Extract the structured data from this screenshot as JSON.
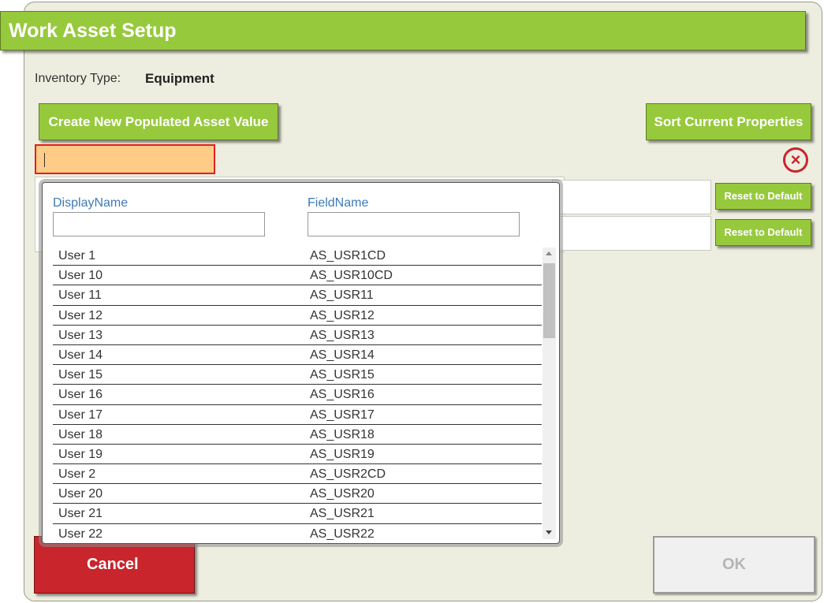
{
  "dialog": {
    "title": "Work Asset Setup",
    "inventory_type_label": "Inventory Type:",
    "inventory_type_value": "Equipment",
    "create_button": "Create New Populated Asset Value",
    "sort_button": "Sort Current Properties",
    "reset_button": "Reset to Default",
    "cancel_button": "Cancel",
    "ok_button": "OK",
    "search_value": "",
    "close_icon": "close-circle-icon"
  },
  "popup": {
    "column_display": "DisplayName",
    "column_field": "FieldName",
    "filter_display": "",
    "filter_field": "",
    "rows": [
      {
        "display": "User 1",
        "field": "AS_USR1CD"
      },
      {
        "display": "User 10",
        "field": "AS_USR10CD"
      },
      {
        "display": "User 11",
        "field": "AS_USR11"
      },
      {
        "display": "User 12",
        "field": "AS_USR12"
      },
      {
        "display": "User 13",
        "field": "AS_USR13"
      },
      {
        "display": "User 14",
        "field": "AS_USR14"
      },
      {
        "display": "User 15",
        "field": "AS_USR15"
      },
      {
        "display": "User 16",
        "field": "AS_USR16"
      },
      {
        "display": "User 17",
        "field": "AS_USR17"
      },
      {
        "display": "User 18",
        "field": "AS_USR18"
      },
      {
        "display": "User 19",
        "field": "AS_USR19"
      },
      {
        "display": "User 2",
        "field": "AS_USR2CD"
      },
      {
        "display": "User 20",
        "field": "AS_USR20"
      },
      {
        "display": "User 21",
        "field": "AS_USR21"
      },
      {
        "display": "User 22",
        "field": "AS_USR22"
      }
    ]
  },
  "colors": {
    "accent_green": "#97c93d",
    "cancel_red": "#c8252d",
    "header_blue": "#3d7ab8",
    "dialog_bg": "#eeeee0",
    "search_bg": "#ffcc88"
  }
}
